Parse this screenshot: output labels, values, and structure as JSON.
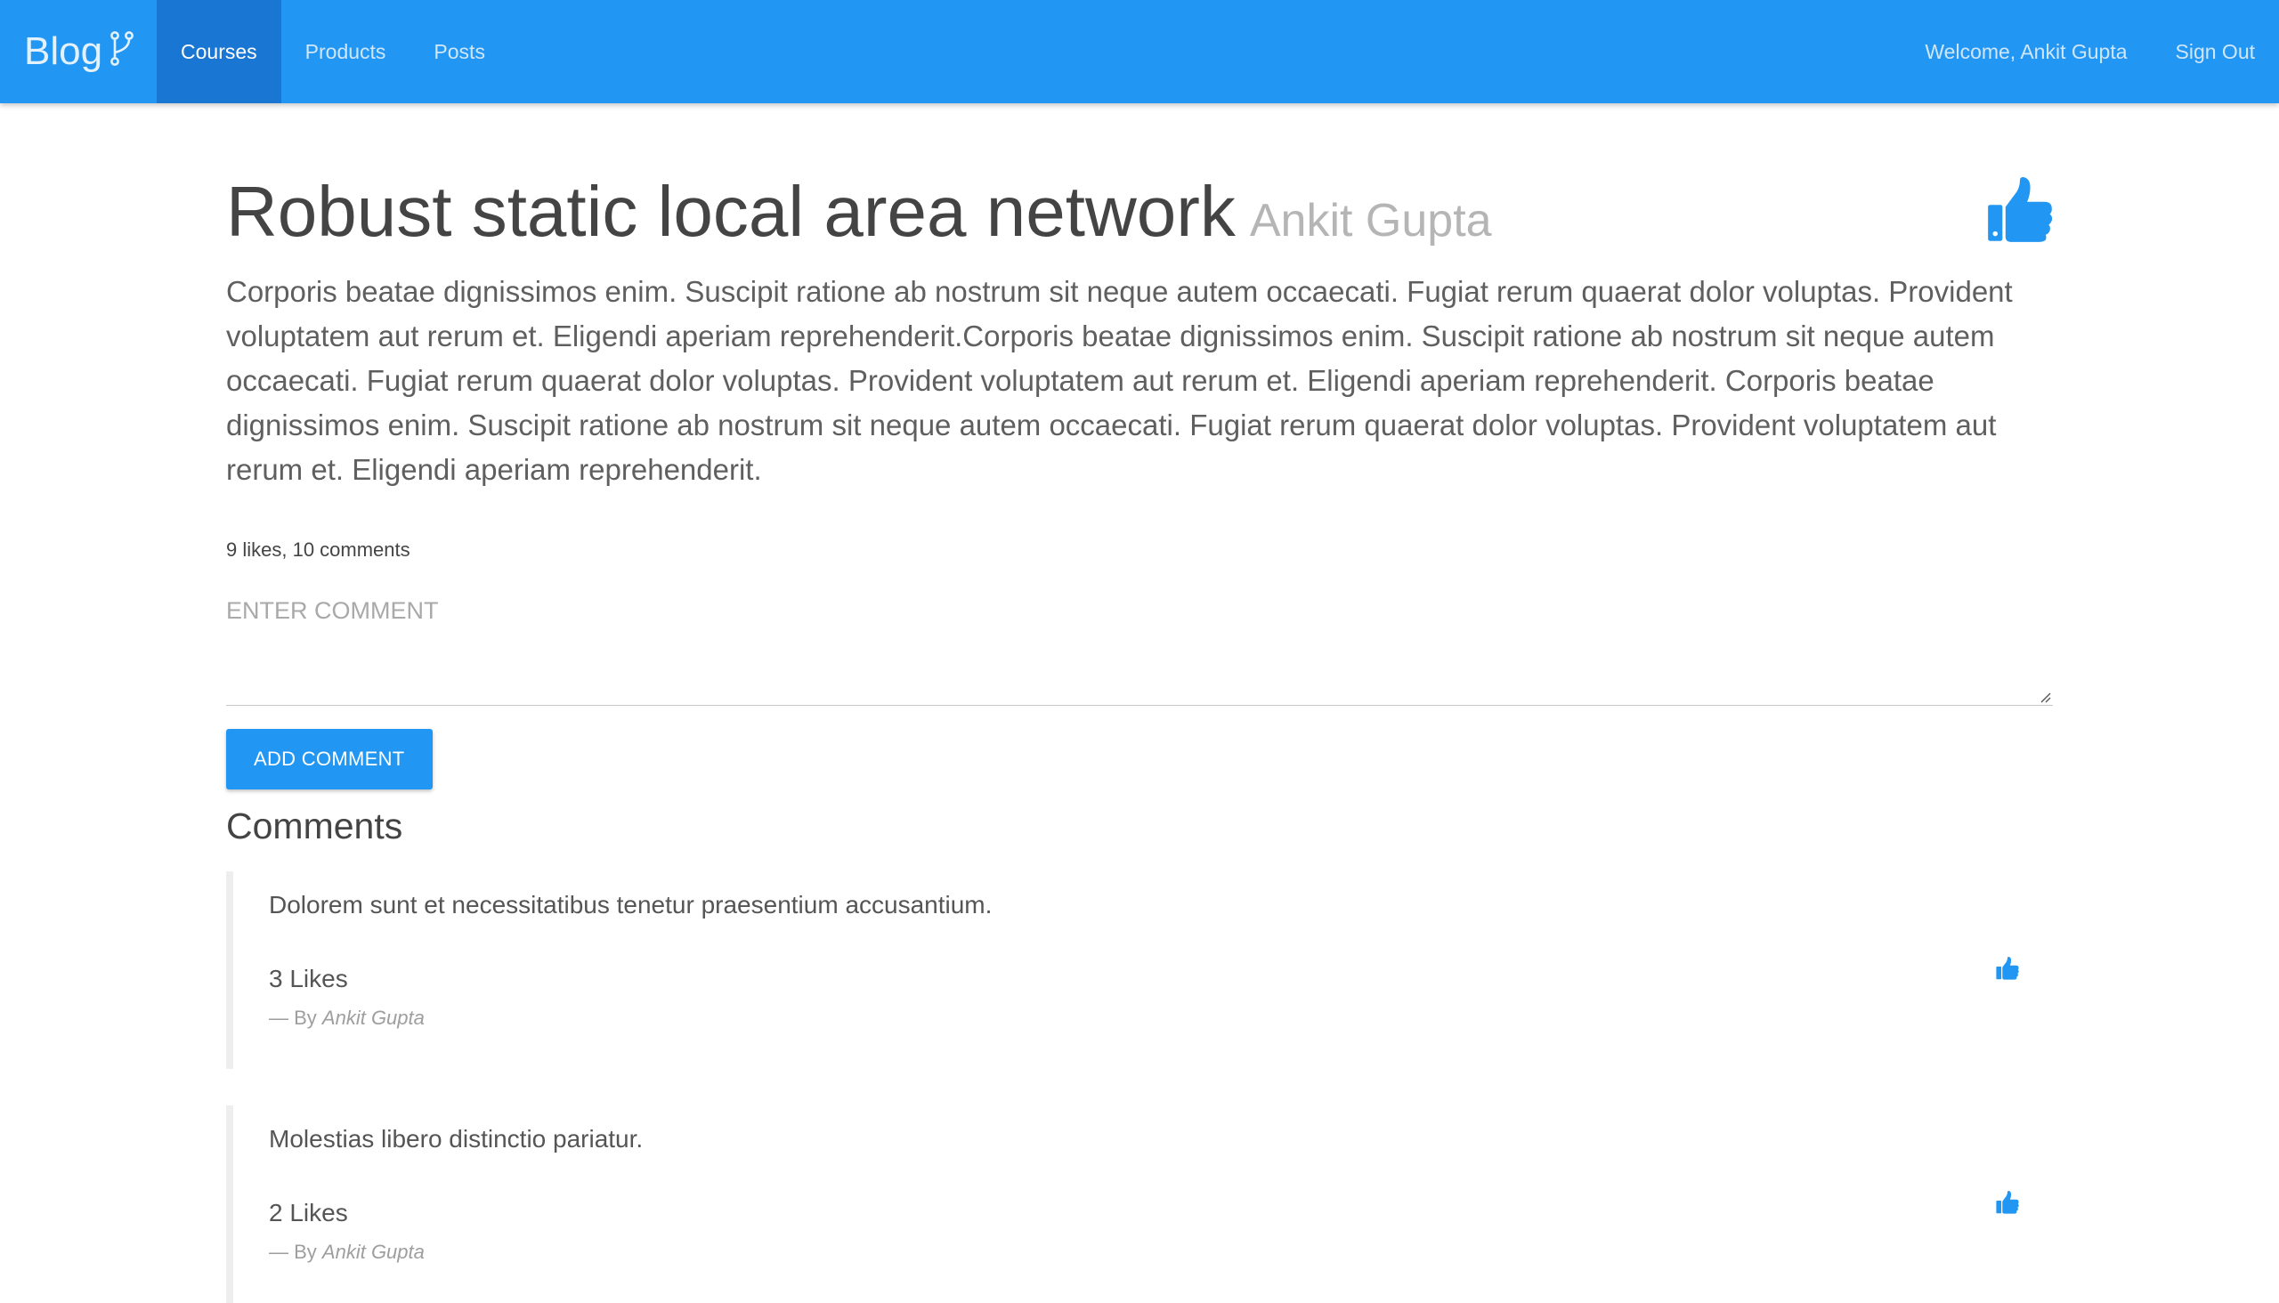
{
  "navbar": {
    "brand": "Blog",
    "items": [
      {
        "label": "Courses",
        "active": true
      },
      {
        "label": "Products",
        "active": false
      },
      {
        "label": "Posts",
        "active": false
      }
    ],
    "welcome": "Welcome, Ankit Gupta",
    "sign_out": "Sign Out"
  },
  "post": {
    "title": "Robust static local area network",
    "author": "Ankit Gupta",
    "body": "Corporis beatae dignissimos enim. Suscipit ratione ab nostrum sit neque autem occaecati. Fugiat rerum quaerat dolor voluptas. Provident voluptatem aut rerum et. Eligendi aperiam reprehenderit.Corporis beatae dignissimos enim. Suscipit ratione ab nostrum sit neque autem occaecati. Fugiat rerum quaerat dolor voluptas. Provident voluptatem aut rerum et. Eligendi aperiam reprehenderit. Corporis beatae dignissimos enim. Suscipit ratione ab nostrum sit neque autem occaecati. Fugiat rerum quaerat dolor voluptas. Provident voluptatem aut rerum et. Eligendi aperiam reprehenderit.",
    "stats": "9 likes, 10 comments"
  },
  "comment_form": {
    "placeholder": "ENTER COMMENT",
    "value": "",
    "button_label": "ADD COMMENT"
  },
  "comments_section": {
    "heading": "Comments",
    "items": [
      {
        "text": "Dolorem sunt et necessitatibus tenetur praesentium accusantium.",
        "likes": "3 Likes",
        "by_prefix": "— By",
        "author": "Ankit Gupta"
      },
      {
        "text": "Molestias libero distinctio pariatur.",
        "likes": "2 Likes",
        "by_prefix": "— By",
        "author": "Ankit Gupta"
      }
    ]
  },
  "colors": {
    "primary": "#2196f3",
    "primary_dark": "#1976d2",
    "text": "#444444",
    "muted": "#b5b5b5"
  },
  "icons": {
    "brand": "code-fork-icon",
    "like": "thumbs-up-icon",
    "textarea": "resize-grip-icon"
  }
}
